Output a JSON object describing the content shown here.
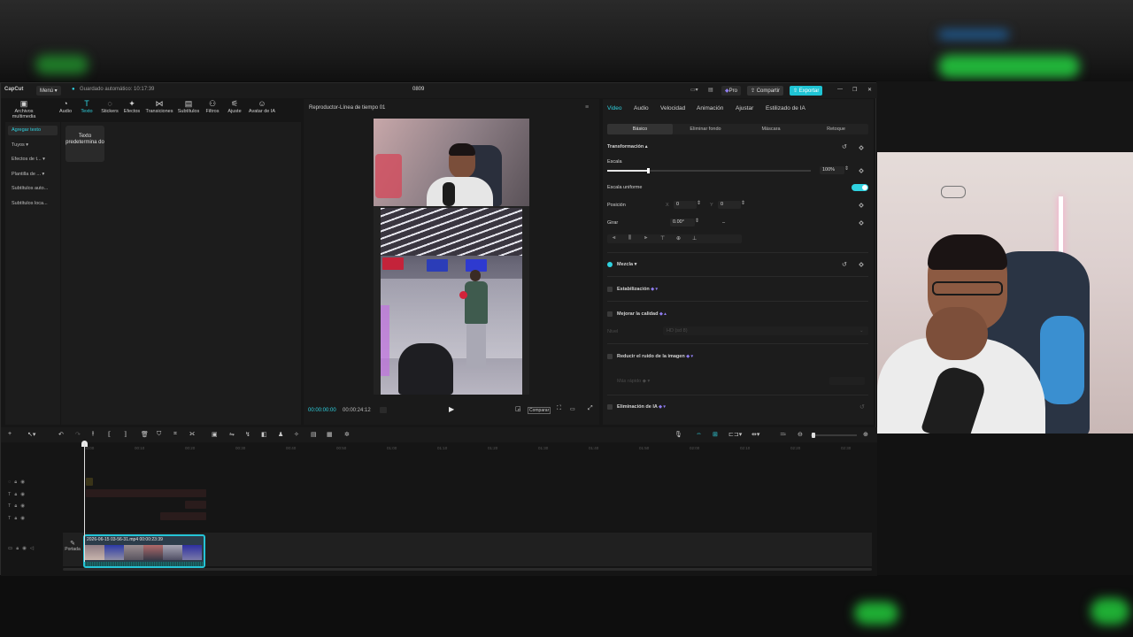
{
  "titlebar": {
    "app_name": "CapCut",
    "menu_label": "Menú ▾",
    "autosave": "Guardado automático: 10:17:39",
    "project_name": "0809",
    "pro_label": "Pro",
    "share_label": "Compartir",
    "export_label": "Exportar"
  },
  "left_tabs": [
    {
      "icon": "media-icon",
      "glyph": "▣",
      "label": "Archivos multimedia"
    },
    {
      "icon": "audio-icon",
      "glyph": "◔",
      "label": "Audio"
    },
    {
      "icon": "text-icon",
      "glyph": "T",
      "label": "Texto"
    },
    {
      "icon": "stickers-icon",
      "glyph": "◌",
      "label": "Stickers"
    },
    {
      "icon": "effects-icon",
      "glyph": "✦",
      "label": "Efectos"
    },
    {
      "icon": "transitions-icon",
      "glyph": "⋈",
      "label": "Transiciones"
    },
    {
      "icon": "subtitles-icon",
      "glyph": "▤",
      "label": "Subtítulos"
    },
    {
      "icon": "filters-icon",
      "glyph": "⚇",
      "label": "Filtros"
    },
    {
      "icon": "adjust-icon",
      "glyph": "⚟",
      "label": "Ajuste"
    },
    {
      "icon": "ai-avatar-icon",
      "glyph": "☺",
      "label": "Avatar de IA"
    }
  ],
  "left_nav": [
    "Agregar texto",
    "Tuyos ▾",
    "Efectos de t... ▾",
    "Plantilla de ... ▾",
    "Subtítulos auto...",
    "Subtítulos loca..."
  ],
  "text_default": "Texto predetermina do",
  "player": {
    "title": "Reproductor-Línea de tiempo 01",
    "current_time": "00:00:00:00",
    "total_time": "00:00:24:12",
    "compare_label": "Comparar"
  },
  "right_panel": {
    "tabs": [
      "Video",
      "Audio",
      "Velocidad",
      "Animación",
      "Ajustar",
      "Estilizado de IA"
    ],
    "subtabs": [
      "Básico",
      "Eliminar fondo",
      "Máscara",
      "Retoque"
    ],
    "transform_label": "Transformación ▴",
    "scale_label": "Escala",
    "scale_value": "100%",
    "scale_fraction": 0.2,
    "uniform_label": "Escala uniforme",
    "position_label": "Posición",
    "pos_x_label": "X",
    "pos_x": "0",
    "pos_y_label": "Y",
    "pos_y": "0",
    "rotate_label": "Girar",
    "rotate_value": "0.00°",
    "rotate_dash": "–",
    "blend_label": "Mezcla ▾",
    "stabilize_label": "Estabilización",
    "enhance_label": "Mejorar la calidad",
    "enhance_level": "Nivel",
    "enhance_value": "HD (sd 8)",
    "denoise_label": "Reducir el ruido de la imagen",
    "denoise_mode": "Más rápido",
    "remove_ai_label": "Eliminación de IA",
    "accent_color": "#2fd2e0",
    "pro_color": "#8f7df0"
  },
  "timeline": {
    "ruler": [
      "00:00",
      "00:10",
      "00:20",
      "00:30",
      "00:40",
      "00:50",
      "01:00",
      "01:10",
      "01:20",
      "01:30",
      "01:40",
      "01:50",
      "02:00",
      "02:10",
      "02:20",
      "02:30"
    ],
    "cover_label": "Portada",
    "clip_label": "2026-06-15 03-56-31.mp4   00:00:23:39",
    "clip_color": "#24c4d6"
  }
}
